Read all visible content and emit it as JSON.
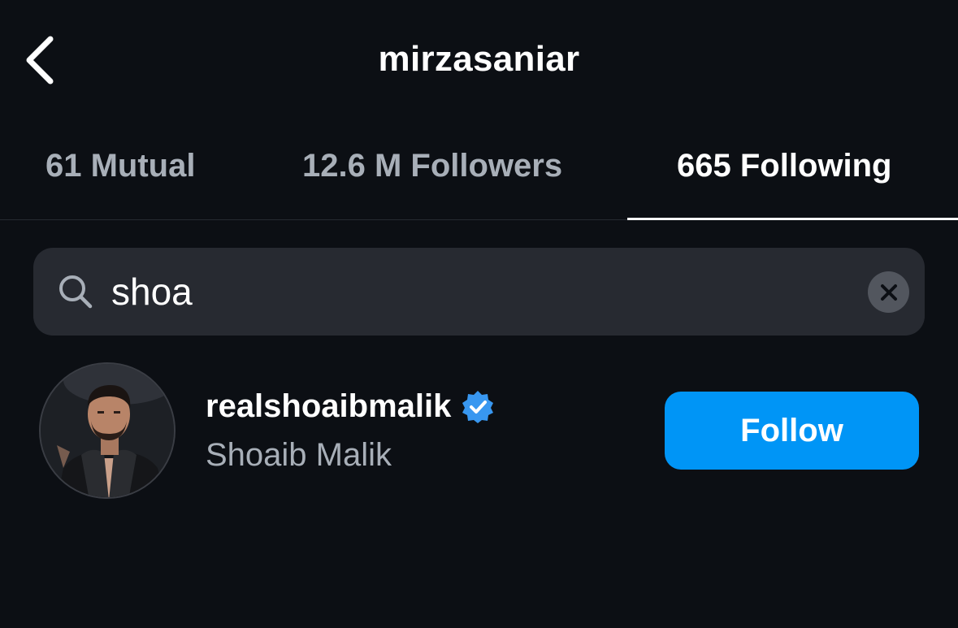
{
  "header": {
    "title": "mirzasaniar",
    "back_icon": "chevron-left-icon"
  },
  "tabs": [
    {
      "label": "61 Mutual",
      "active": false
    },
    {
      "label": "12.6 M Followers",
      "active": false
    },
    {
      "label": "665 Following",
      "active": true
    }
  ],
  "search": {
    "icon": "search-icon",
    "value": "shoa",
    "clear_icon": "close-icon"
  },
  "results": [
    {
      "username": "realshoaibmalik",
      "verified": true,
      "full_name": "Shoaib Malik",
      "button_label": "Follow"
    }
  ],
  "colors": {
    "background": "#0c0f14",
    "search_bg": "#272a31",
    "accent": "#0095f6",
    "verified_badge": "#3897f0",
    "muted_text": "#a8afb8"
  }
}
